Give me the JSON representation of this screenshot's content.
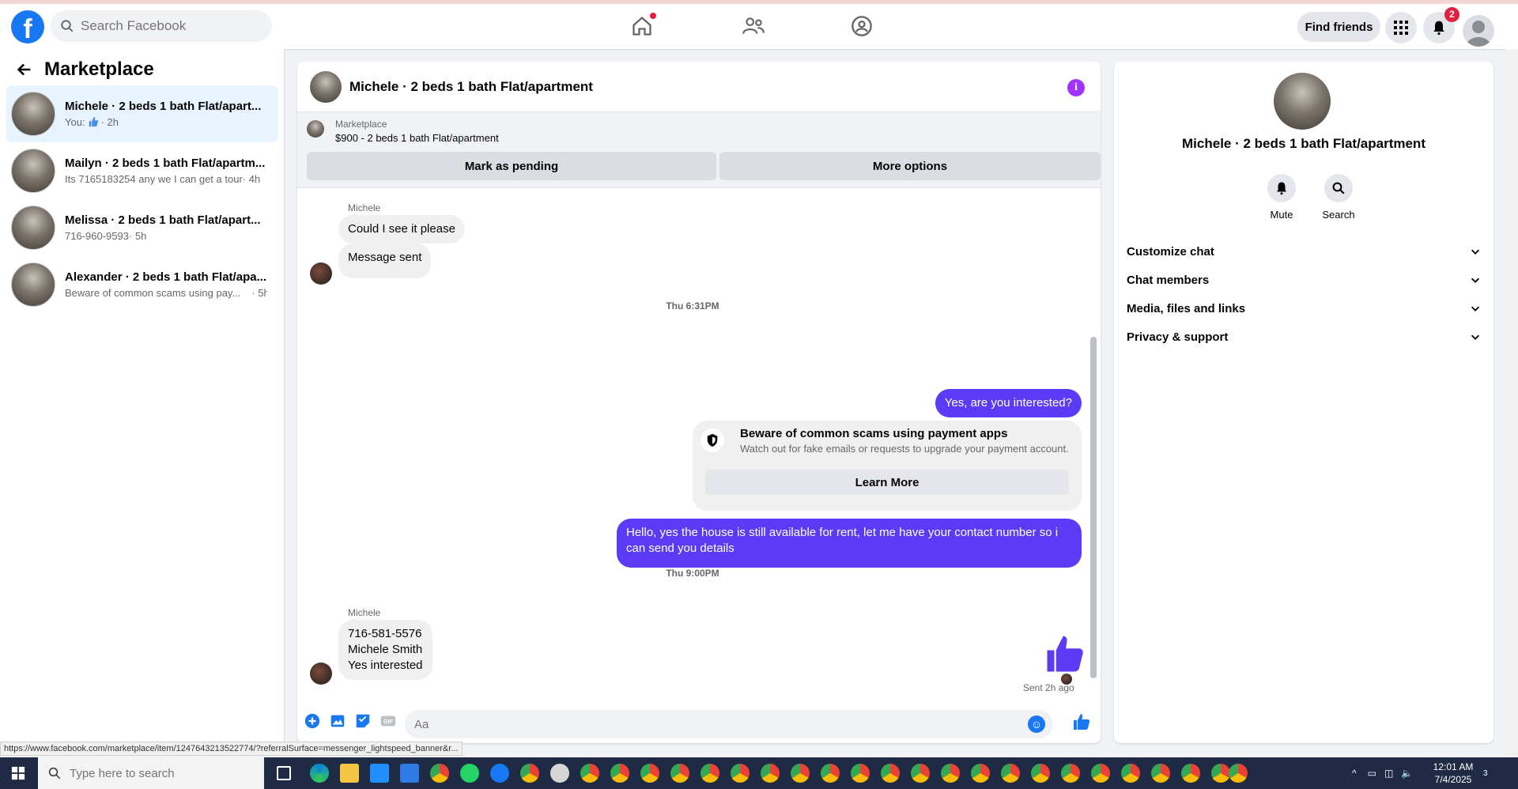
{
  "topbar": {
    "search_placeholder": "Search Facebook",
    "find_friends": "Find friends",
    "notifications_count": "2"
  },
  "left": {
    "title": "Marketplace",
    "conversations": [
      {
        "title": "Michele · 2 beds 1 bath Flat/apart...",
        "sub": "You:",
        "time": "· 2h",
        "active": true
      },
      {
        "title": "Mailyn · 2 beds 1 bath Flat/apartm...",
        "sub": "Its 7165183254 any we I can get a tour",
        "time": "· 4h"
      },
      {
        "title": "Melissa · 2 beds 1 bath Flat/apart...",
        "sub": "716-960-9593",
        "time": "· 5h"
      },
      {
        "title": "Alexander · 2 beds 1 bath Flat/apa...",
        "sub": "Beware of common scams using pay...",
        "time": "· 5h"
      }
    ]
  },
  "chat": {
    "title": "Michele · 2 beds 1 bath Flat/apartment",
    "marketplace_label": "Marketplace",
    "listing": "$900 - 2 beds 1 bath Flat/apartment",
    "mark_pending": "Mark as pending",
    "more_options": "More options",
    "sender1": "Michele",
    "msg_could_see": "Could I see it please",
    "msg_sent": "Message sent",
    "time1": "Thu 6:31PM",
    "msg_interested": "Yes, are you interested?",
    "scam_title": "Beware of common scams using payment apps",
    "scam_sub": "Watch out for fake emails or requests to upgrade your payment account.",
    "learn_more": "Learn More",
    "msg_hello_line1": "Hello, yes the house is still available for rent, let me have your contact number so i",
    "msg_hello_line2": "can send you details",
    "time2": "Thu 9:00PM",
    "sender2": "Michele",
    "msg_phone": "716-581-5576",
    "msg_name": "Michele Smith",
    "msg_yes": "Yes interested",
    "sent_ago": "Sent 2h ago",
    "composer_placeholder": "Aa"
  },
  "right": {
    "name": "Michele · 2 beds 1 bath Flat/apartment",
    "mute": "Mute",
    "search": "Search",
    "sections": [
      "Customize chat",
      "Chat members",
      "Media, files and links",
      "Privacy & support"
    ]
  },
  "status_url": "https://www.facebook.com/marketplace/item/1247643213522774/?referralSurface=messenger_lightspeed_banner&r...",
  "taskbar": {
    "search_placeholder": "Type here to search",
    "time": "12:01 AM",
    "date": "7/4/2025",
    "notif_count": "3"
  },
  "colors": {
    "brand": "#1877f2",
    "outgoing_bubble": "#5b3bf5",
    "info": "#a033ff",
    "badge": "#e41e3f"
  }
}
